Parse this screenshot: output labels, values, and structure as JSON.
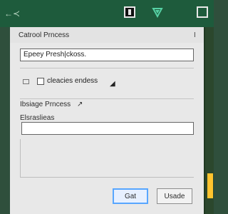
{
  "topbar": {
    "left_icons": [
      "←",
      "≺"
    ]
  },
  "dialog": {
    "title": "Catrool Prncess",
    "close_mark": "I",
    "main_input": {
      "value": "Epeey Presh|ckoss."
    },
    "option": {
      "label": "cleacies endess",
      "cursor_mark": "◢"
    },
    "section": {
      "title": "Ibsiage Prncess",
      "mark": "↗",
      "field_label": "Elsraslieas"
    },
    "buttons": {
      "primary": "Gat",
      "secondary": "Usade"
    }
  },
  "colors": {
    "topbar": "#1e5b3c",
    "accent": "#ffc42e",
    "dialog": "#e8e8e8",
    "focus": "#58a6ff"
  }
}
